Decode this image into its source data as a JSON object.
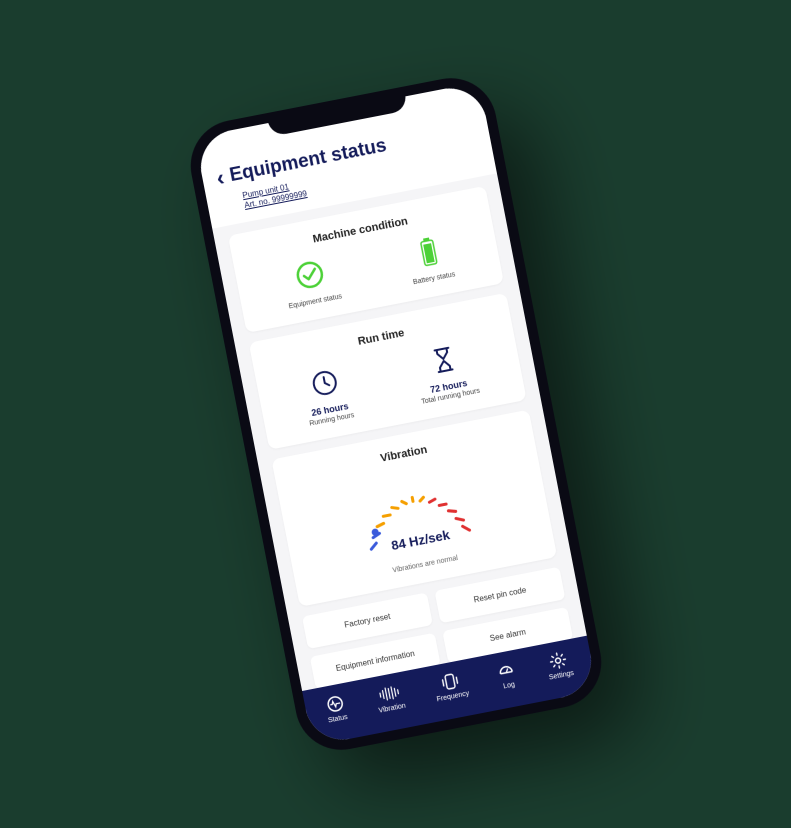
{
  "header": {
    "title": "Equipment status",
    "unit_name": "Pump unit 01",
    "art_no": "Art. no. 99999999"
  },
  "cards": {
    "machine_condition": {
      "title": "Machine condition",
      "equipment_label": "Equipment status",
      "battery_label": "Battery status"
    },
    "run_time": {
      "title": "Run time",
      "running_value": "26 hours",
      "running_label": "Running hours",
      "total_value": "72 hours",
      "total_label": "Total running hours"
    },
    "vibration": {
      "title": "Vibration",
      "value": "84 Hz/sek",
      "note": "Vibrations are normal"
    }
  },
  "buttons": {
    "factory_reset": "Factory reset",
    "reset_pin": "Reset pin code",
    "equipment_info": "Equipment information",
    "see_alarm": "See alarm"
  },
  "nav": {
    "status": "Status",
    "vibration": "Vibration",
    "frequency": "Frequency",
    "log": "Log",
    "settings": "Settings"
  },
  "colors": {
    "primary": "#141b5a",
    "success": "#4cd137"
  }
}
